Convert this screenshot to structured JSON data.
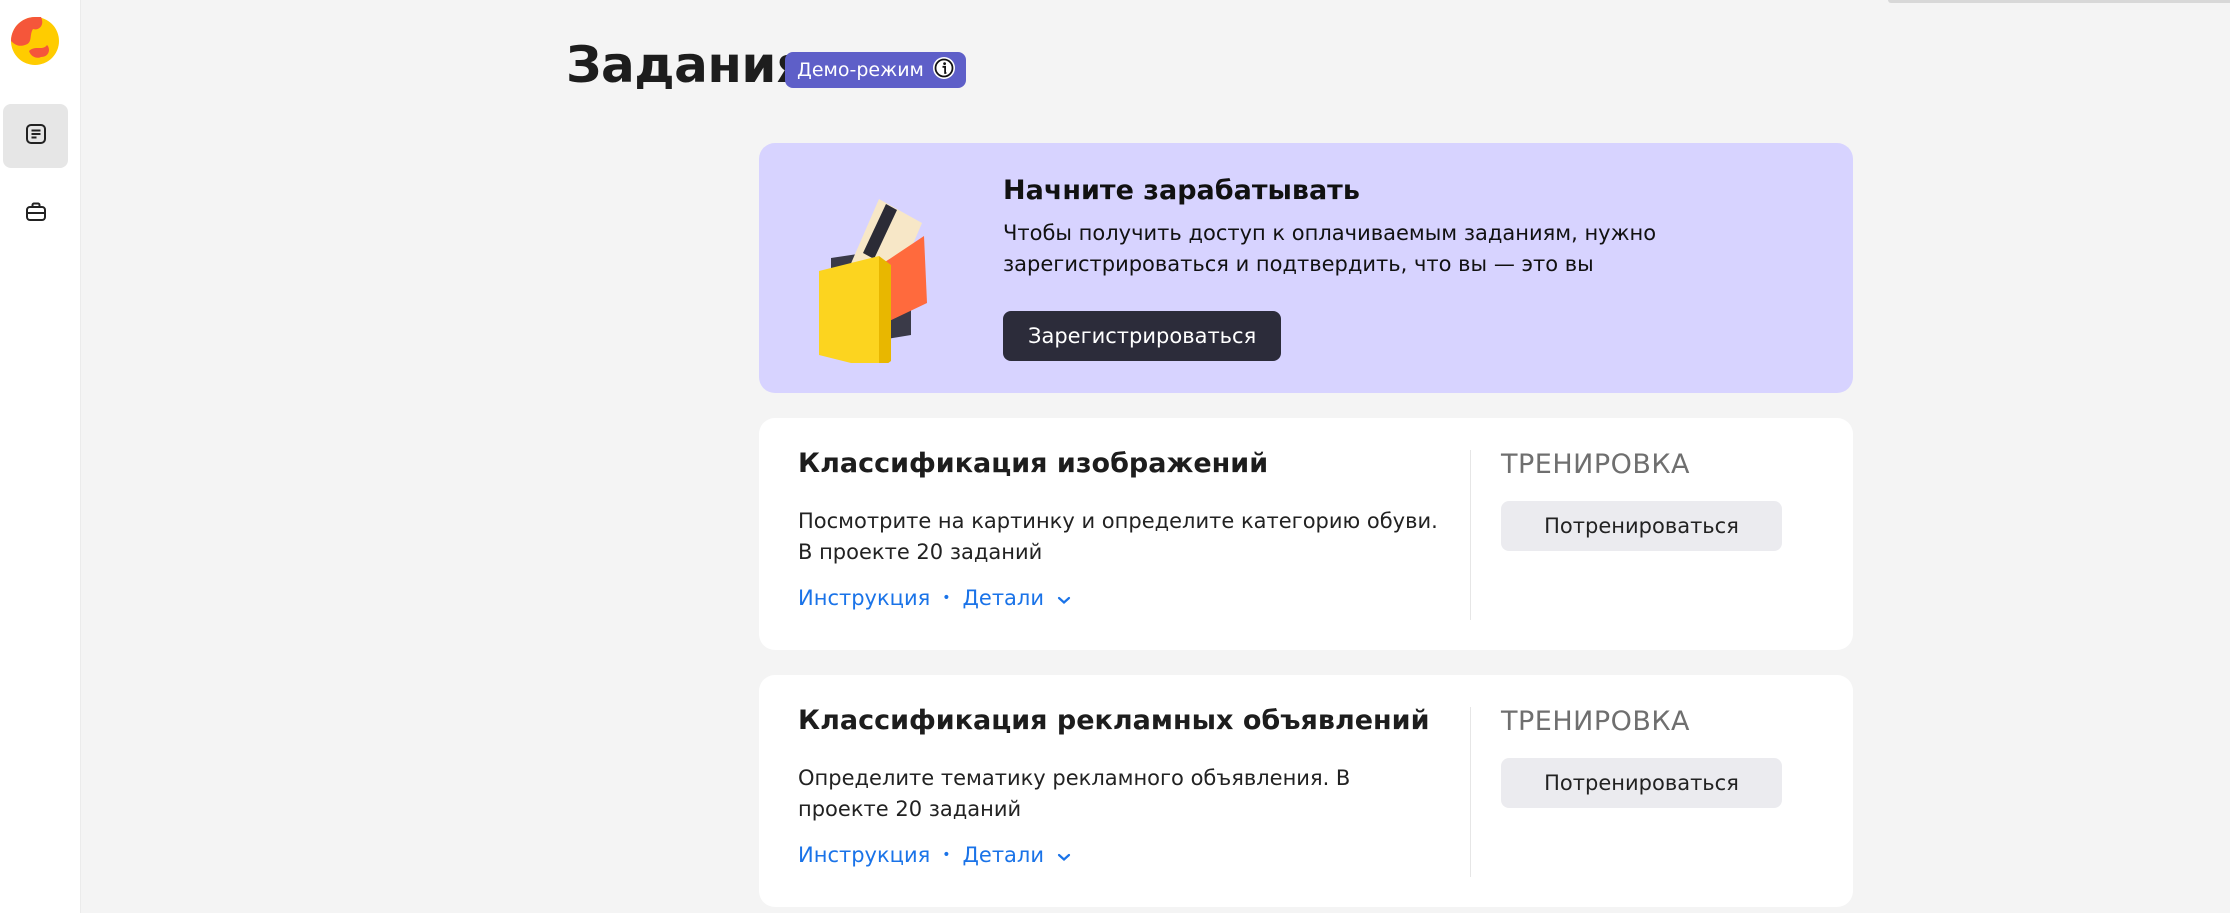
{
  "page": {
    "title": "Задания",
    "demo_badge": "Демо-режим"
  },
  "sidebar": {
    "items": [
      {
        "icon": "tasks-list-icon",
        "active": true
      },
      {
        "icon": "briefcase-icon",
        "active": false
      }
    ]
  },
  "promo": {
    "title": "Начните зарабатывать",
    "text": "Чтобы получить доступ к оплачиваемым заданиям, нужно зарегистрироваться и подтвердить, что вы — это вы",
    "button_label": "Зарегистрироваться"
  },
  "cards": [
    {
      "title": "Классификация изображений",
      "description": "Посмотрите на картинку и определите категорию обуви. В проекте 20 заданий",
      "instruction_link": "Инструкция",
      "details_link": "Детали",
      "mode": "ТРЕНИРОВКА",
      "button_label": "Потренироваться"
    },
    {
      "title": "Классификация рекламных объявлений",
      "description": "Определите тематику рекламного объявления. В проекте 20 заданий",
      "instruction_link": "Инструкция",
      "details_link": "Детали",
      "mode": "ТРЕНИРОВКА",
      "button_label": "Потренироваться"
    }
  ],
  "colors": {
    "accent_link": "#1a73e8",
    "badge": "#5e5fc8",
    "promo_bg": "#d7d3ff",
    "primary_button": "#2c2c3a"
  }
}
